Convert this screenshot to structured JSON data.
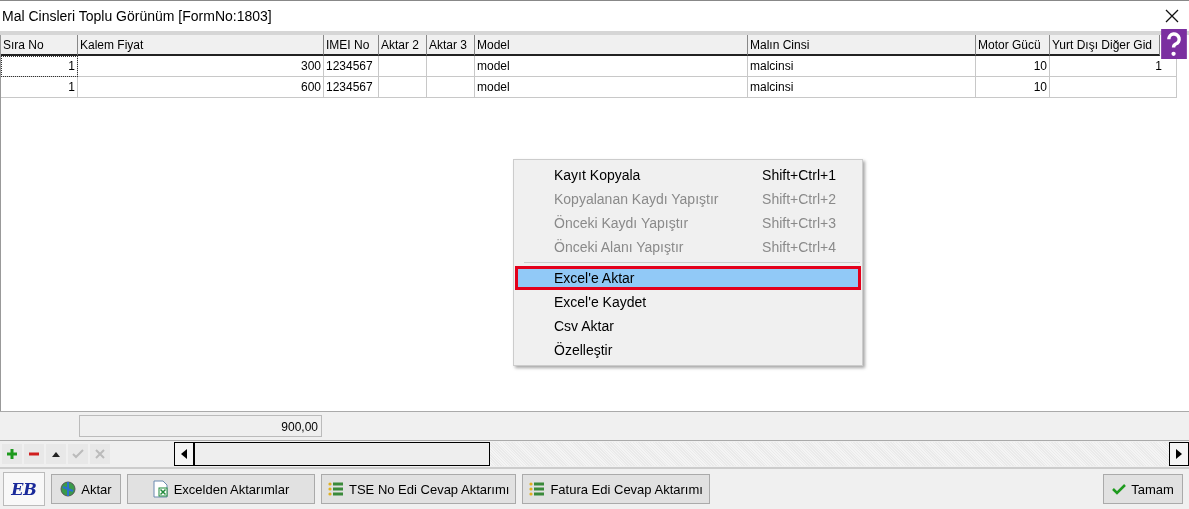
{
  "window": {
    "title": "Mal Cinsleri Toplu Görünüm [FormNo:1803]"
  },
  "table": {
    "columns": [
      {
        "label": "Sıra No"
      },
      {
        "label": "Kalem Fiyat"
      },
      {
        "label": "IMEI No"
      },
      {
        "label": "Aktar 2"
      },
      {
        "label": "Aktar 3"
      },
      {
        "label": "Model"
      },
      {
        "label": "Malın Cinsi"
      },
      {
        "label": "Motor Gücü"
      },
      {
        "label": "Yurt Dışı Diğer Gid"
      }
    ],
    "rows": [
      {
        "selected": true,
        "cells": [
          "1",
          "300",
          "1234567",
          "",
          "",
          "model",
          "malcinsi",
          "10",
          "1"
        ]
      },
      {
        "selected": false,
        "cells": [
          "1",
          "600",
          "1234567",
          "",
          "",
          "model",
          "malcinsi",
          "10",
          ""
        ]
      }
    ],
    "total": "900,00"
  },
  "context_menu": [
    {
      "label": "Kayıt Kopyala",
      "shortcut": "Shift+Ctrl+1",
      "disabled": false,
      "selected": false
    },
    {
      "label": "Kopyalanan Kaydı Yapıştır",
      "shortcut": "Shift+Ctrl+2",
      "disabled": true,
      "selected": false
    },
    {
      "label": "Önceki Kaydı Yapıştır",
      "shortcut": "Shift+Ctrl+3",
      "disabled": true,
      "selected": false
    },
    {
      "label": "Önceki Alanı Yapıştır",
      "shortcut": "Shift+Ctrl+4",
      "disabled": true,
      "selected": false,
      "separator_after": true
    },
    {
      "label": "Excel'e Aktar",
      "disabled": false,
      "selected": true
    },
    {
      "label": "Excel'e Kaydet",
      "disabled": false,
      "selected": false
    },
    {
      "label": "Csv Aktar",
      "disabled": false,
      "selected": false
    },
    {
      "label": "Özelleştir",
      "disabled": false,
      "selected": false
    }
  ],
  "grid_tools": [
    {
      "kind": "add",
      "disabled": false
    },
    {
      "kind": "remove",
      "disabled": false
    },
    {
      "kind": "up",
      "disabled": false
    },
    {
      "kind": "check",
      "disabled": true
    },
    {
      "kind": "cancel",
      "disabled": true
    }
  ],
  "logo": "EB",
  "buttons": [
    {
      "label": "Aktar",
      "kind": "globe"
    },
    {
      "label": "Excelden Aktarımlar",
      "kind": "excel"
    },
    {
      "label": "TSE No Edi Cevap Aktarımı",
      "kind": "list"
    },
    {
      "label": "Fatura Edi Cevap Aktarımı",
      "kind": "list"
    }
  ],
  "ok_button": "Tamam"
}
